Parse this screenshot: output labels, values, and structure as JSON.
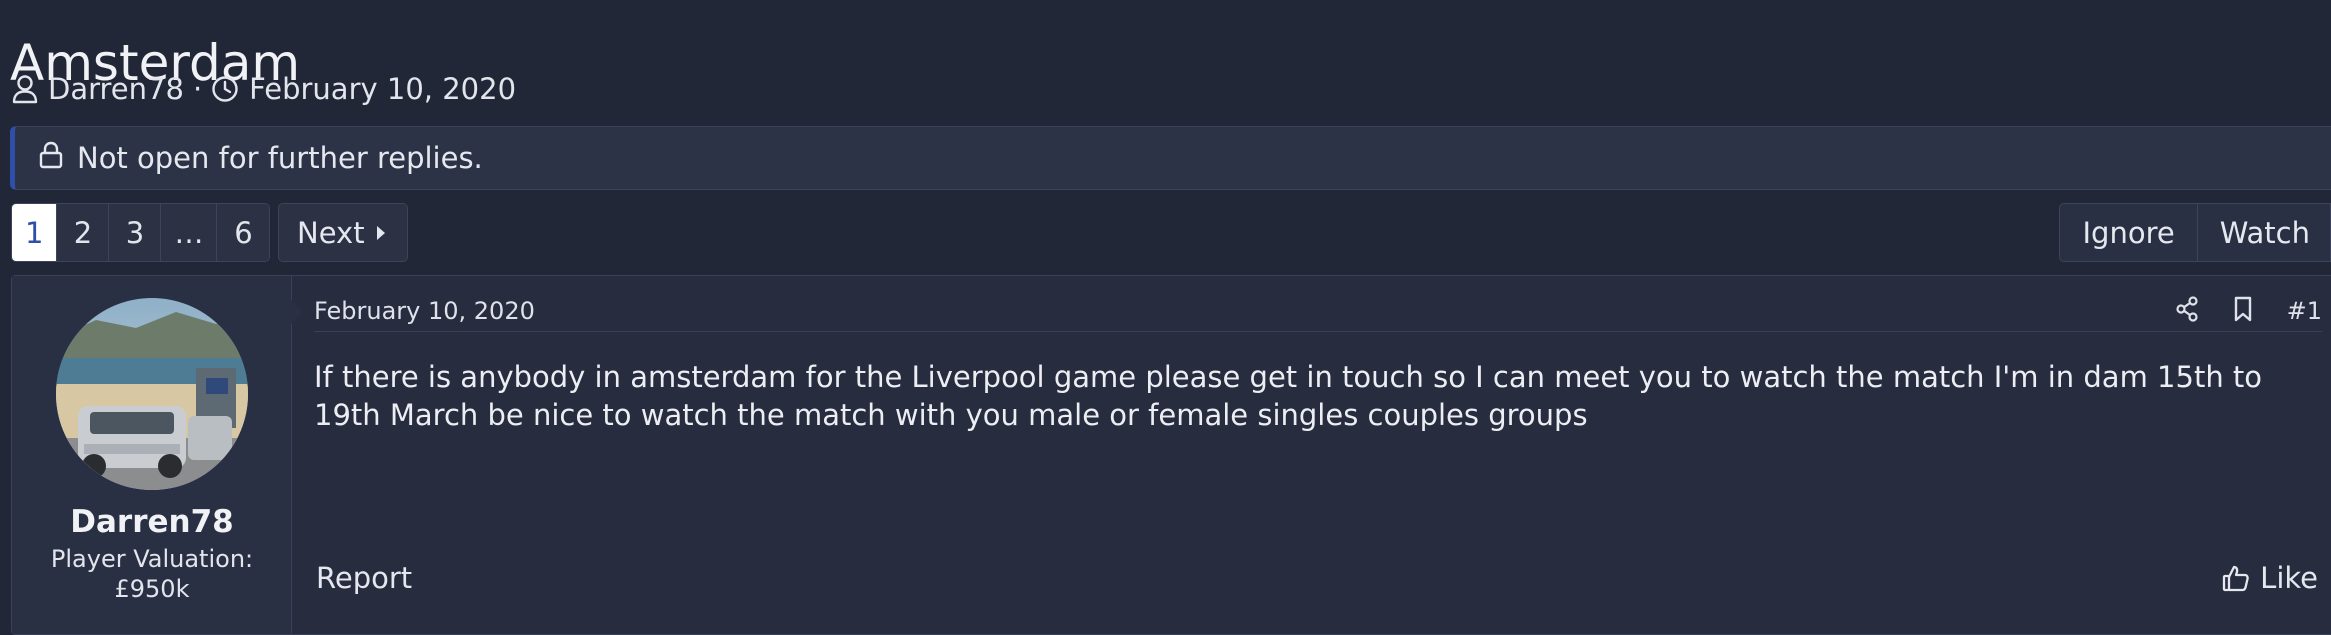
{
  "thread": {
    "title": "Amsterdam",
    "author": "Darren78",
    "separator": "·",
    "date": "February 10, 2020"
  },
  "notice": {
    "text": "Not open for further replies."
  },
  "pagination": {
    "pages": [
      "1",
      "2",
      "3",
      "…",
      "6"
    ],
    "current": "1",
    "next_label": "Next"
  },
  "thread_actions": {
    "ignore_label": "Ignore",
    "watch_label": "Watch"
  },
  "post": {
    "user": {
      "name": "Darren78",
      "title_line1": "Player Valuation:",
      "title_line2": "£950k"
    },
    "date": "February 10, 2020",
    "number": "#1",
    "body": "If there is anybody in amsterdam for the Liverpool game please get in touch so I can meet you to watch the match I'm in dam 15th to 19th March be nice to watch the match with you male or female singles couples groups",
    "report_label": "Report",
    "like_label": "Like"
  },
  "colors": {
    "background": "#222737",
    "accent": "#2f4fa8",
    "panel": "#2d3347"
  },
  "icons": {
    "author": "user-icon",
    "date": "clock-icon",
    "notice": "lock-icon",
    "share": "share-icon",
    "bookmark": "bookmark-icon",
    "like": "thumbs-up-icon"
  }
}
